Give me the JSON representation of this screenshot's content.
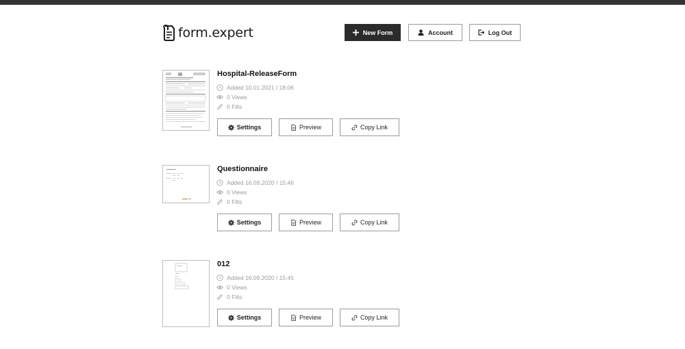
{
  "header": {
    "logo_text": "form.expert",
    "new_form_label": "New Form",
    "account_label": "Account",
    "logout_label": "Log Out"
  },
  "forms": [
    {
      "title": "Hospital-ReleaseForm",
      "added": "Added 10.01.2021 / 18:06",
      "views": "0 Views",
      "fills": "0 Fills",
      "settings_label": "Settings",
      "preview_label": "Preview",
      "copy_label": "Copy Link"
    },
    {
      "title": "Questionnaire",
      "added": "Added 16.09.2020 / 15:46",
      "views": "0 Views",
      "fills": "0 Fills",
      "settings_label": "Settings",
      "preview_label": "Preview",
      "copy_label": "Copy Link"
    },
    {
      "title": "012",
      "added": "Added 16.09.2020 / 15:45",
      "views": "0 Views",
      "fills": "0 Fills",
      "settings_label": "Settings",
      "preview_label": "Preview",
      "copy_label": "Copy Link"
    }
  ],
  "icons": {
    "new_form": "plus-icon",
    "account": "user-icon",
    "logout": "logout-icon",
    "added": "clock-icon",
    "views": "eye-icon",
    "fills": "pencil-icon",
    "settings": "gear-icon",
    "preview": "document-icon",
    "copy_link": "link-icon"
  },
  "colors": {
    "topbar": "#333333",
    "primary_button": "#2b2b2b",
    "meta_text": "#9a9a9a",
    "border": "#9a9a9a"
  }
}
